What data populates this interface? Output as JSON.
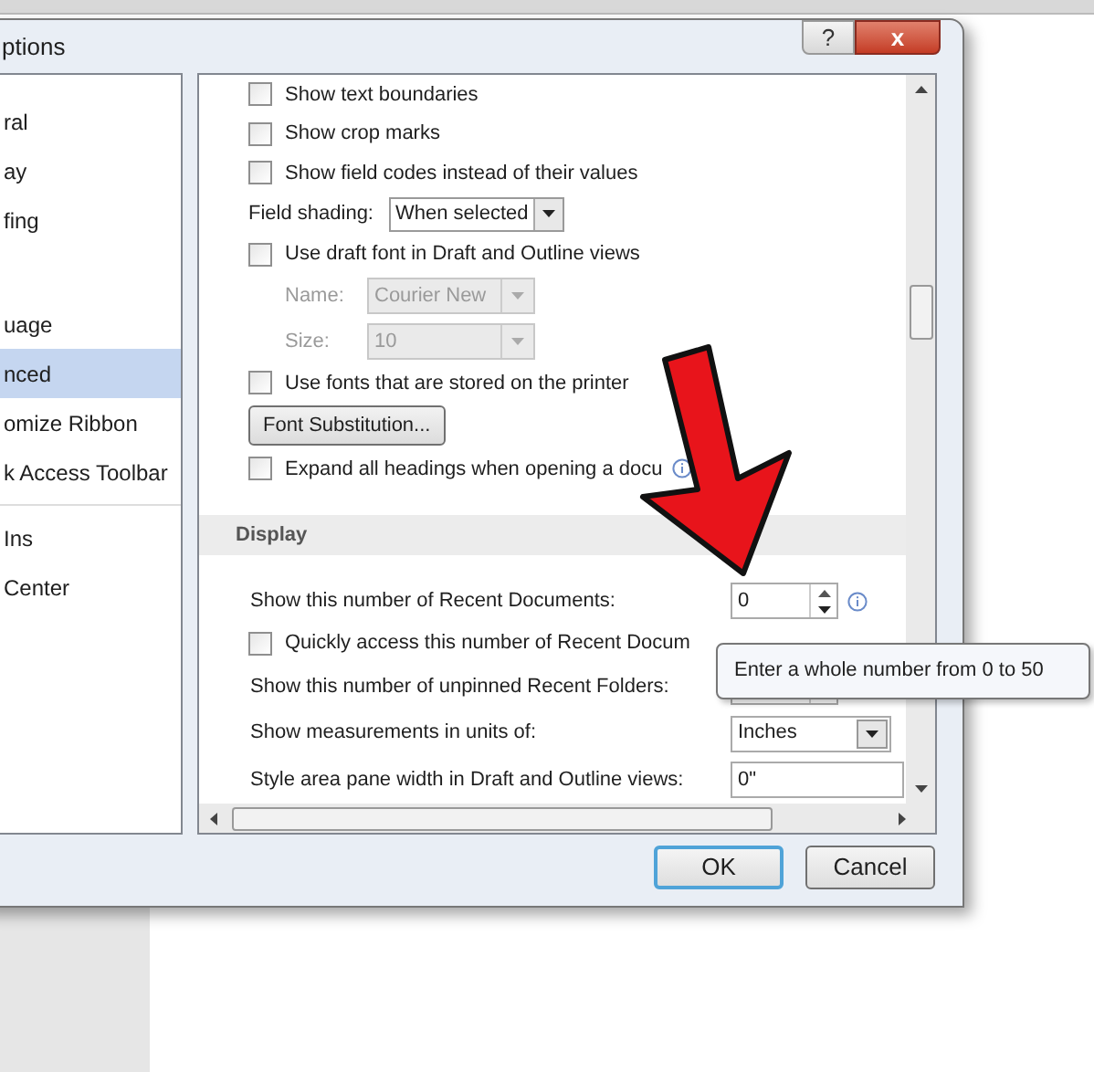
{
  "window": {
    "title": "ptions",
    "help": "?",
    "close": "x"
  },
  "sidebar": {
    "items": [
      {
        "label": "ral",
        "selected": false
      },
      {
        "label": "ay",
        "selected": false
      },
      {
        "label": "fing",
        "selected": false
      },
      {
        "label": "uage",
        "selected": false
      },
      {
        "label": "nced",
        "selected": true
      },
      {
        "label": "omize Ribbon",
        "selected": false
      },
      {
        "label": "k Access Toolbar",
        "selected": false
      },
      {
        "label": "Ins",
        "selected": false
      },
      {
        "label": "Center",
        "selected": false
      }
    ]
  },
  "options": [
    {
      "kind": "checkbox",
      "label": "Show text boundaries",
      "checked": false
    },
    {
      "kind": "checkbox",
      "label": "Show crop marks",
      "checked": false
    },
    {
      "kind": "checkbox",
      "label": "Show field codes instead of their values",
      "checked": false
    },
    {
      "kind": "dropdown",
      "label": "Field shading:",
      "value": "When selected",
      "disabled": false
    },
    {
      "kind": "checkbox",
      "label": "Use draft font in Draft and Outline views",
      "checked": false
    },
    {
      "kind": "subdropdown",
      "label": "Name:",
      "value": "Courier New",
      "disabled": true
    },
    {
      "kind": "subdropdown",
      "label": "Size:",
      "value": "10",
      "disabled": true
    },
    {
      "kind": "checkbox",
      "label": "Use fonts that are stored on the printer",
      "checked": false
    },
    {
      "kind": "button",
      "label": "Font Substitution..."
    },
    {
      "kind": "checkbox",
      "label": "Expand all headings when opening a docu",
      "checked": false,
      "info": true
    },
    {
      "kind": "section",
      "label": "Display"
    },
    {
      "kind": "spinner",
      "label": "Show this number of Recent Documents:",
      "value": "0",
      "info": true
    },
    {
      "kind": "checkbox",
      "label": "Quickly access this number of Recent Docum",
      "checked": false
    },
    {
      "kind": "spinner",
      "label": "Show this number of unpinned Recent Folders:"
    },
    {
      "kind": "select",
      "label": "Show measurements in units of:",
      "value": "Inches"
    },
    {
      "kind": "textfield",
      "label": "Style area pane width in Draft and Outline views:",
      "value": "0\""
    }
  ],
  "tooltip": "Enter a whole number from 0 to 50",
  "buttons": [
    {
      "label": "OK",
      "default": true
    },
    {
      "label": "Cancel",
      "default": false
    }
  ]
}
